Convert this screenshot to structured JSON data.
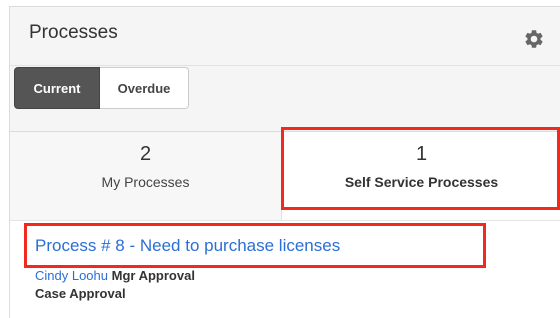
{
  "dashlet": {
    "title": "Processes",
    "gear_icon": "gear-icon"
  },
  "toolbar": {
    "tabs": [
      {
        "label": "Current",
        "active": true
      },
      {
        "label": "Overdue",
        "active": false
      }
    ]
  },
  "stats": {
    "my_processes": {
      "count": "2",
      "label": "My Processes"
    },
    "self_service": {
      "count": "1",
      "label": "Self Service Processes"
    }
  },
  "process": {
    "title": "Process  # 8 -  Need to purchase licenses",
    "user": "Cindy Loohu",
    "task": "Mgr Approval",
    "subtitle": "Case Approval"
  },
  "colors": {
    "highlight": "#f02a1f",
    "link": "#2b6ed6",
    "active_tab": "#555555"
  }
}
